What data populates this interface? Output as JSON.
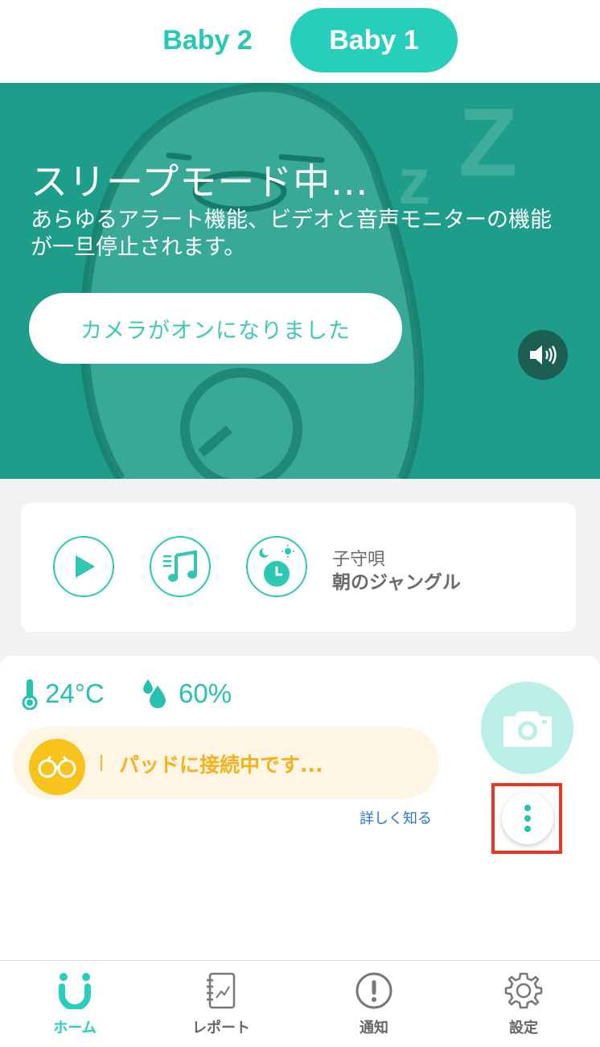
{
  "tabs": [
    {
      "label": "Baby 2",
      "active": false
    },
    {
      "label": "Baby 1",
      "active": true
    }
  ],
  "hero": {
    "title": "スリープモード中...",
    "description": "あらゆるアラート機能、ビデオと音声モニターの機能が一旦停止されます。",
    "camera_button": "カメラがオンになりました",
    "volume_icon": "speaker-icon"
  },
  "lullaby": {
    "label": "子守唄",
    "song": "朝のジャングル",
    "buttons": [
      "play-icon",
      "music-list-icon",
      "timer-icon"
    ]
  },
  "environment": {
    "temperature": "24°C",
    "humidity": "60%"
  },
  "pad_status": {
    "text": "パッドに接続中です...",
    "learn_more": "詳しく知る"
  },
  "bottom_nav": [
    {
      "label": "ホーム",
      "icon": "home-icon",
      "active": true
    },
    {
      "label": "レポート",
      "icon": "report-icon",
      "active": false
    },
    {
      "label": "通知",
      "icon": "notification-icon",
      "active": false
    },
    {
      "label": "設定",
      "icon": "settings-icon",
      "active": false
    }
  ],
  "colors": {
    "accent": "#27cfba",
    "hero_bg": "#1e9e8a",
    "pad_status": "#f4b21c",
    "highlight": "#e8371f"
  }
}
